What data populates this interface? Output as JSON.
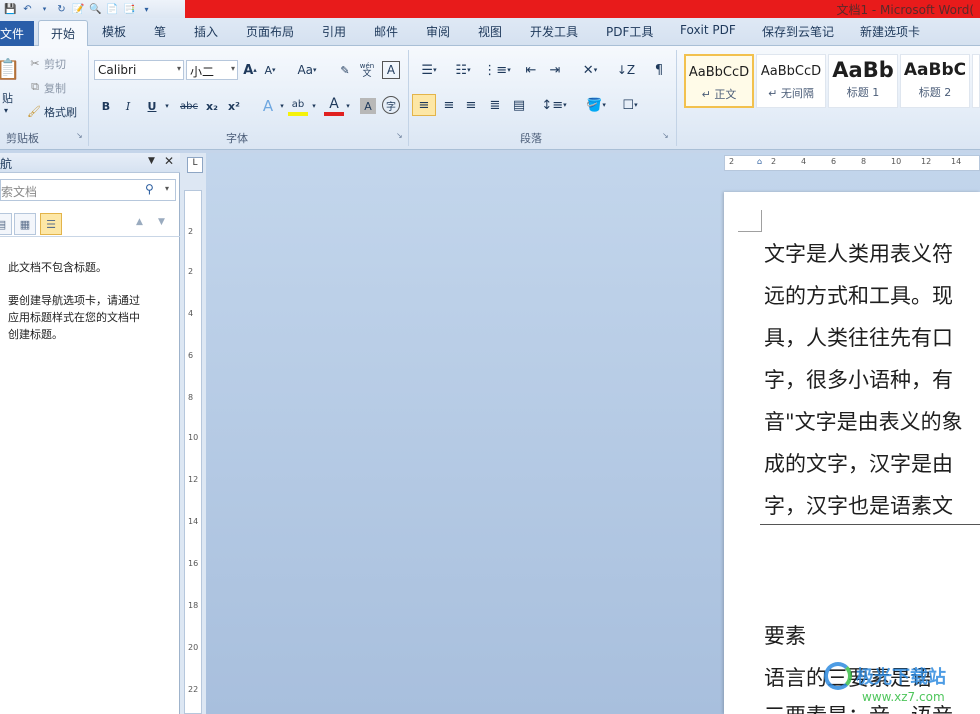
{
  "window": {
    "title": "文档1 - Microsoft Word("
  },
  "tabs": {
    "file": "文件",
    "items": [
      "开始",
      "模板",
      "笔",
      "插入",
      "页面布局",
      "引用",
      "邮件",
      "审阅",
      "视图",
      "开发工具",
      "PDF工具",
      "Foxit PDF",
      "保存到云笔记",
      "新建选项卡"
    ]
  },
  "clipboard": {
    "paste": "贴",
    "cut": "剪切",
    "copy": "复制",
    "format_painter": "格式刷",
    "label": "剪贴板"
  },
  "font": {
    "name": "Calibri",
    "size": "小二",
    "grow": "A",
    "shrink": "A",
    "change_case": "Aa",
    "phonetic": "wén",
    "bold": "B",
    "italic": "I",
    "underline": "U",
    "strike": "abc",
    "subscript": "x₂",
    "superscript": "x²",
    "font_color": "A",
    "char_shading": "A",
    "enclose": "字",
    "label": "字体"
  },
  "paragraph": {
    "label": "段落"
  },
  "styles": [
    {
      "sample": "AaBbCcD",
      "name": "↵ 正文",
      "selected": true
    },
    {
      "sample": "AaBbCcD",
      "name": "↵ 无间隔",
      "selected": false
    },
    {
      "sample": "AaBb",
      "name": "标题 1",
      "selected": false
    },
    {
      "sample": "AaBbC",
      "name": "标题 2",
      "selected": false
    }
  ],
  "nav": {
    "title": "航",
    "search_placeholder": "索文档",
    "msg1": "此文档不包含标题。",
    "msg2_line1": "要创建导航选项卡，请通过",
    "msg2_line2": "应用标题样式在您的文档中",
    "msg2_line3": "创建标题。"
  },
  "document": {
    "lines": [
      "文字是人类用表义符",
      "远的方式和工具。现",
      "具，人类往往先有口",
      "字，很多小语种，有",
      "音\"文字是由表义的象",
      "成的文字，汉字是由",
      "字，汉字也是语素文"
    ],
    "heading": "要素",
    "line_after_1": "语言的三要素是语",
    "line_after_2": "三要素是：音，语音"
  },
  "watermark": {
    "text": "极光下载站",
    "url": "www.xz7.com"
  },
  "ruler": {
    "vertical": [
      "2",
      "2",
      "4",
      "6",
      "8",
      "10",
      "12",
      "14",
      "16",
      "18",
      "20",
      "22"
    ],
    "horizontal": [
      "2",
      "2",
      "4",
      "6",
      "8",
      "10",
      "12",
      "14"
    ]
  },
  "colors": {
    "accent": "#2a5ea9",
    "title_bar": "#e81b1b",
    "selected_style": "#f2c14e"
  }
}
